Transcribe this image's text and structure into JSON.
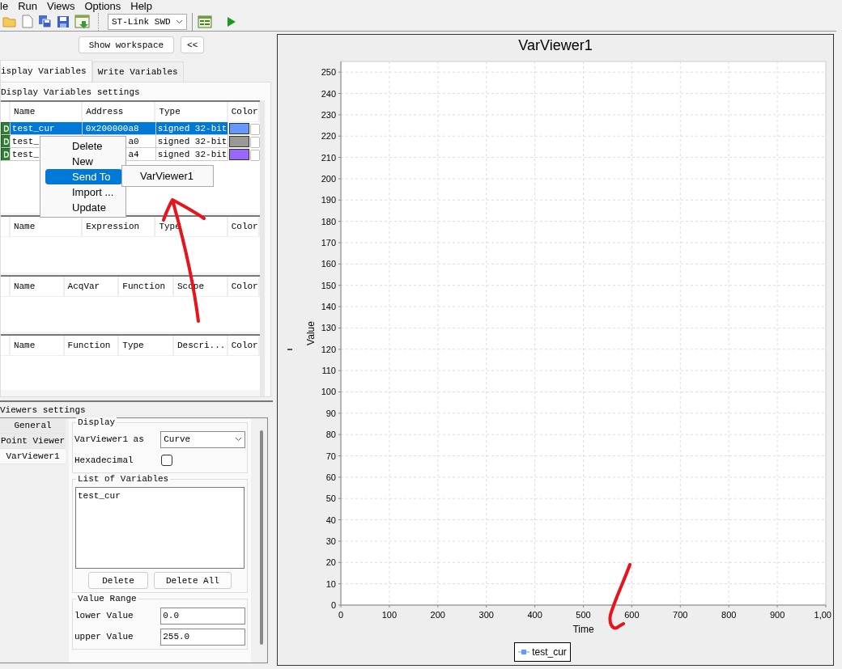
{
  "menu_bar": [
    "le",
    "Run",
    "Views",
    "Options",
    "Help"
  ],
  "toolbar": {
    "connection": "ST-Link SWD"
  },
  "workspace_button": "Show workspace",
  "collapse_button": "<<",
  "tabs": [
    {
      "label": "isplay Variables",
      "selected": true
    },
    {
      "label": "Write Variables",
      "selected": false
    }
  ],
  "display_settings": {
    "title": "Display Variables settings",
    "variables_table": {
      "columns": [
        "Name",
        "Address",
        "Type",
        "Color"
      ],
      "rows": [
        {
          "name": "test_cur",
          "address": "0x200000a8",
          "type": "signed 32-bit",
          "color": "#6699ff",
          "selected": true
        },
        {
          "name": "test_",
          "address": "a0",
          "type": "signed 32-bit",
          "color": "#999999",
          "selected": false
        },
        {
          "name": "test_",
          "address": "a4",
          "type": "signed 32-bit",
          "color": "#9966ff",
          "selected": false
        }
      ]
    },
    "expressions_table": {
      "columns": [
        "Name",
        "Expression",
        "Type",
        "Color"
      ]
    },
    "acquisition_table": {
      "columns": [
        "Name",
        "AcqVar",
        "Function",
        "Scope",
        "Color"
      ]
    },
    "functions_table": {
      "columns": [
        "Name",
        "Function",
        "Type",
        "Descri...",
        "Color"
      ]
    }
  },
  "context_menu": {
    "items": [
      {
        "label": "Delete",
        "selected": false
      },
      {
        "label": "New",
        "selected": false
      },
      {
        "label": "Send To",
        "selected": true
      },
      {
        "label": "Import ...",
        "selected": false
      },
      {
        "label": "Update",
        "selected": false
      }
    ],
    "submenu": [
      "VarViewer1"
    ]
  },
  "viewers_settings": {
    "title": "Viewers settings",
    "items": [
      {
        "label": "General",
        "selected": false
      },
      {
        "label": "Point Viewer",
        "selected": false
      },
      {
        "label": "VarViewer1",
        "selected": true
      }
    ],
    "display_group": {
      "title": "Display",
      "as_label": "VarViewer1 as",
      "as_value": "Curve",
      "hex_label": "Hexadecimal",
      "hex_checked": false
    },
    "variables_group": {
      "title": "List of Variables",
      "items": [
        "test_cur"
      ],
      "buttons": [
        "Delete",
        "Delete All"
      ]
    },
    "range_group": {
      "title": "Value Range",
      "lower_label": "lower Value",
      "lower_value": "0.0",
      "upper_label": "upper Value",
      "upper_value": "255.0"
    }
  },
  "viewer": {
    "chart_data": {
      "type": "line",
      "title": "VarViewer1",
      "xlabel": "Time",
      "ylabel": "Value",
      "grid": true,
      "xlim": [
        0,
        1000
      ],
      "ylim": [
        0,
        255
      ],
      "xticks": [
        0,
        100,
        200,
        300,
        400,
        500,
        600,
        700,
        800,
        900
      ],
      "yticks": [
        0,
        10,
        20,
        30,
        40,
        50,
        60,
        70,
        80,
        90,
        100,
        110,
        120,
        130,
        140,
        150,
        160,
        170,
        180,
        190,
        200,
        210,
        220,
        230,
        240,
        250
      ]
    },
    "edge_tick_label": "1,00",
    "legend": [
      {
        "name": "test_cur",
        "color": "#6699ff"
      }
    ]
  }
}
